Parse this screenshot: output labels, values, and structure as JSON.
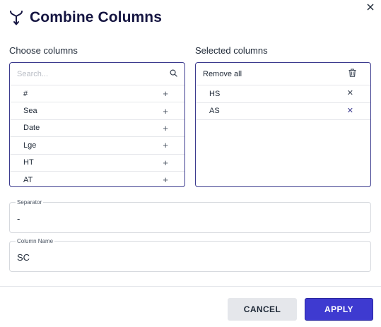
{
  "dialog": {
    "title": "Combine Columns",
    "title_icon": "merge-columns-icon"
  },
  "choose": {
    "label": "Choose columns",
    "search_placeholder": "Search...",
    "items": [
      {
        "label": "#"
      },
      {
        "label": "Sea"
      },
      {
        "label": "Date"
      },
      {
        "label": "Lge"
      },
      {
        "label": "HT"
      },
      {
        "label": "AT"
      }
    ]
  },
  "selected": {
    "label": "Selected columns",
    "remove_all_label": "Remove all",
    "items": [
      {
        "label": "HS"
      },
      {
        "label": "AS"
      }
    ]
  },
  "separator": {
    "label": "Separator",
    "value": "-"
  },
  "column_name": {
    "label": "Column Name",
    "value": "SC"
  },
  "buttons": {
    "cancel_label": "CANCEL",
    "apply_label": "APPLY"
  },
  "colors": {
    "accent": "#3e3ad0",
    "panel_border": "#3b3a8e",
    "title": "#151541"
  }
}
